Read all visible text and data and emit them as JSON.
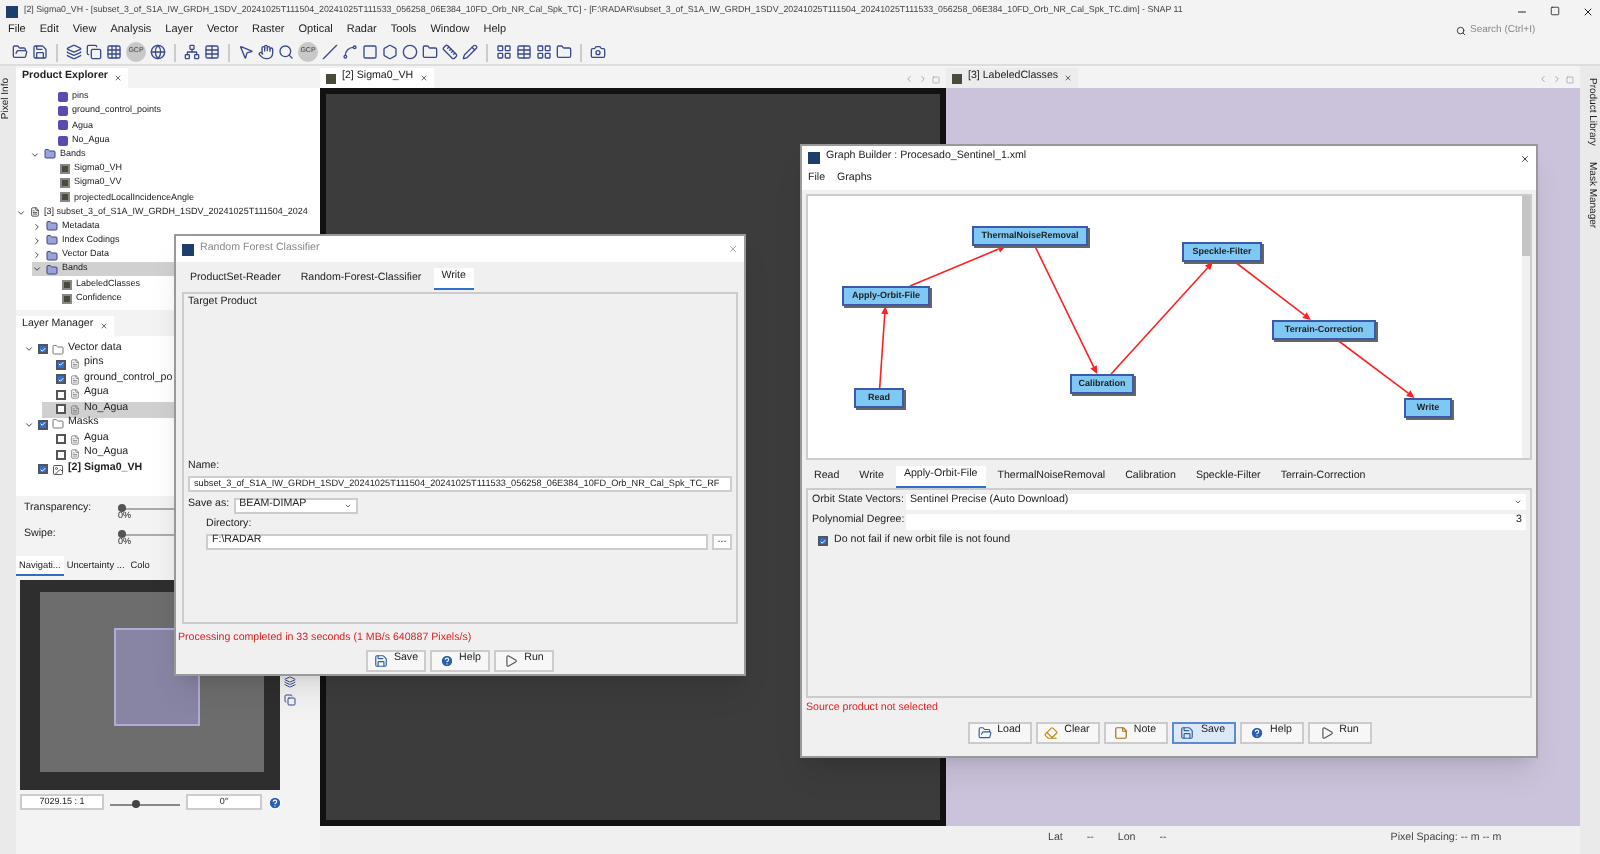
{
  "window": {
    "title": "[2] Sigma0_VH - [subset_3_of_S1A_IW_GRDH_1SDV_20241025T111504_20241025T111533_056258_06E384_10FD_Orb_NR_Cal_Spk_TC] - [F:\\RADAR\\subset_3_of_S1A_IW_GRDH_1SDV_20241025T111504_20241025T111533_056258_06E384_10FD_Orb_NR_Cal_Spk_TC.dim] - SNAP 11"
  },
  "search": {
    "placeholder": "Search (Ctrl+I)"
  },
  "menu": [
    "File",
    "Edit",
    "View",
    "Analysis",
    "Layer",
    "Vector",
    "Raster",
    "Optical",
    "Radar",
    "Tools",
    "Window",
    "Help"
  ],
  "toolbar": {
    "gcp_labels": [
      "GCP",
      "GCP"
    ]
  },
  "side_tabs_left": [
    "Pixel Info"
  ],
  "side_tabs_right": [
    "Product Library",
    "Mask Manager"
  ],
  "product_explorer": {
    "tab": "Product Explorer",
    "tree": [
      {
        "children": [
          {
            "children": [
              {
                "label": "pins",
                "kind": "vector",
                "selected": false
              },
              {
                "label": "ground_control_points",
                "kind": "vector",
                "selected": false
              },
              {
                "label": "Agua",
                "kind": "vector",
                "selected": false
              },
              {
                "label": "No_Agua",
                "kind": "vector",
                "selected": false
              }
            ]
          },
          {
            "label": "Bands",
            "kind": "folder",
            "selected": false,
            "expanded": true,
            "children": [
              {
                "label": "Sigma0_VH",
                "kind": "band",
                "selected": false
              },
              {
                "label": "Sigma0_VV",
                "kind": "band",
                "selected": false
              },
              {
                "label": "projectedLocalIncidenceAngle",
                "kind": "band",
                "selected": false
              }
            ]
          }
        ]
      },
      {
        "label": "[3] subset_3_of_S1A_IW_GRDH_1SDV_20241025T111504_2024",
        "kind": "product",
        "selected": false,
        "expanded": true,
        "children": [
          {
            "label": "Metadata",
            "kind": "folder",
            "selected": false,
            "expanded": false
          },
          {
            "label": "Index Codings",
            "kind": "folder",
            "selected": false,
            "expanded": false
          },
          {
            "label": "Vector Data",
            "kind": "folder",
            "selected": false,
            "expanded": false
          },
          {
            "label": "Bands",
            "kind": "folder",
            "selected": true,
            "expanded": true,
            "children": [
              {
                "label": "LabeledClasses",
                "kind": "band",
                "selected": false
              },
              {
                "label": "Confidence",
                "kind": "band",
                "selected": false
              }
            ]
          }
        ]
      }
    ]
  },
  "layer_manager": {
    "tab": "Layer Manager",
    "tree": [
      {
        "label": "Vector data",
        "kind": "group",
        "checked": true,
        "expanded": true,
        "selected": false,
        "children": [
          {
            "label": "pins",
            "kind": "layer",
            "checked": true,
            "selected": false
          },
          {
            "label": "ground_control_po",
            "kind": "layer",
            "checked": true,
            "selected": false
          },
          {
            "label": "Agua",
            "kind": "layer",
            "checked": false,
            "selected": false
          },
          {
            "label": "No_Agua",
            "kind": "layer",
            "checked": false,
            "selected": true
          }
        ]
      },
      {
        "label": "Masks",
        "kind": "group",
        "checked": true,
        "expanded": true,
        "selected": false,
        "children": [
          {
            "label": "Agua",
            "kind": "layer",
            "checked": false,
            "selected": false
          },
          {
            "label": "No_Agua",
            "kind": "layer",
            "checked": false,
            "selected": false
          }
        ]
      },
      {
        "label": "[2] Sigma0_VH",
        "kind": "raster",
        "checked": true,
        "selected": false
      }
    ],
    "sliders": [
      {
        "label": "Transparency:",
        "level": 0,
        "reading": "0%"
      },
      {
        "label": "Swipe:",
        "level": 0,
        "reading": "0%"
      }
    ]
  },
  "navigation": {
    "tabs": [
      {
        "label": "Navigati...",
        "selected": true
      },
      {
        "label": "Uncertainty ...",
        "selected": false
      },
      {
        "label": "Colo",
        "selected": false
      }
    ],
    "zoom": "7029.15 : 1",
    "zoom_slider": {
      "level": 0.3
    },
    "rotation": "0°"
  },
  "views": [
    {
      "tab": "[2] Sigma0_VH",
      "selected": true,
      "kind": "dark"
    },
    {
      "tab": "[3] LabeledClasses",
      "selected": false,
      "kind": "light"
    }
  ],
  "status_bar": {
    "lat_label": "Lat",
    "lat": "--",
    "lon_label": "Lon",
    "lon": "--",
    "pixel_spacing": "Pixel Spacing: -- m -- m"
  },
  "random_forest": {
    "title": "Random Forest Classifier",
    "tabs": [
      {
        "label": "ProductSet-Reader",
        "selected": false
      },
      {
        "label": "Random-Forest-Classifier",
        "selected": false
      },
      {
        "label": "Write",
        "selected": true
      }
    ],
    "group": "Target Product",
    "name_label": "Name:",
    "name": "subset_3_of_S1A_IW_GRDH_1SDV_20241025T111504_20241025T111533_056258_06E384_10FD_Orb_NR_Cal_Spk_TC_RF",
    "save_as_label": "Save as:",
    "save_as": "BEAM-DIMAP",
    "directory_label": "Directory:",
    "directory": "F:\\RADAR",
    "browse": "...",
    "status": "Processing completed in 33 seconds (1 MB/s 640887 Pixels/s)",
    "buttons": [
      {
        "label": "Save",
        "kind": "save"
      },
      {
        "label": "Help",
        "kind": "help"
      },
      {
        "label": "Run",
        "kind": "run"
      }
    ]
  },
  "graph_builder": {
    "title": "Graph Builder : Procesado_Sentinel_1.xml",
    "menu": [
      "File",
      "Graphs"
    ],
    "graph": {
      "nodes": [
        {
          "label": "Read"
        },
        {
          "label": "Write"
        },
        {
          "label": "Apply-Orbit-File"
        },
        {
          "label": "ThermalNoiseRemoval"
        },
        {
          "label": "Calibration"
        },
        {
          "label": "Speckle-Filter"
        },
        {
          "label": "Terrain-Correction"
        }
      ]
    },
    "tabs": [
      {
        "label": "Read",
        "selected": false
      },
      {
        "label": "Write",
        "selected": false
      },
      {
        "label": "Apply-Orbit-File",
        "selected": true
      },
      {
        "label": "ThermalNoiseRemoval",
        "selected": false
      },
      {
        "label": "Calibration",
        "selected": false
      },
      {
        "label": "Speckle-Filter",
        "selected": false
      },
      {
        "label": "Terrain-Correction",
        "selected": false
      }
    ],
    "orbit_label": "Orbit State Vectors:",
    "orbit": "Sentinel Precise (Auto Download)",
    "degree_label": "Polynomial Degree:",
    "degree": "3",
    "no_fail": {
      "label": "Do not fail if new orbit file is not found",
      "checked": true
    },
    "status": "Source product not selected",
    "buttons": [
      {
        "label": "Load",
        "kind": "load",
        "selected": false
      },
      {
        "label": "Clear",
        "kind": "clear",
        "selected": false
      },
      {
        "label": "Note",
        "kind": "note",
        "selected": false
      },
      {
        "label": "Save",
        "kind": "save",
        "selected": true
      },
      {
        "label": "Help",
        "kind": "help",
        "selected": false
      },
      {
        "label": "Run",
        "kind": "run",
        "selected": false
      }
    ]
  }
}
